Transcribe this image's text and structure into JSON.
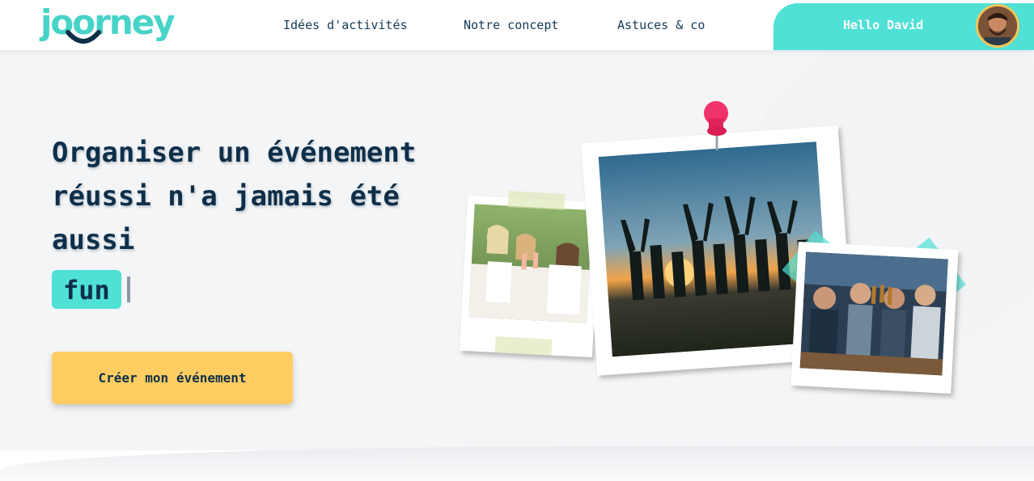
{
  "header": {
    "logo_text": "joorney",
    "nav": [
      {
        "label": "Idées d'activités"
      },
      {
        "label": "Notre concept"
      },
      {
        "label": "Astuces & co"
      }
    ],
    "greeting": "Hello David"
  },
  "hero": {
    "title": "Organiser un événement réussi n'a jamais été aussi",
    "highlight_word": "fun",
    "cta_label": "Créer mon événement"
  },
  "colors": {
    "accent_teal": "#4fe0d6",
    "cta_yellow": "#ffcd61",
    "text_navy": "#0e2f4a",
    "pin_pink": "#f0336a"
  },
  "photos": [
    {
      "subject": "friends toasting outdoors"
    },
    {
      "subject": "group silhouettes at sunset"
    },
    {
      "subject": "friends cheering with beers"
    }
  ]
}
